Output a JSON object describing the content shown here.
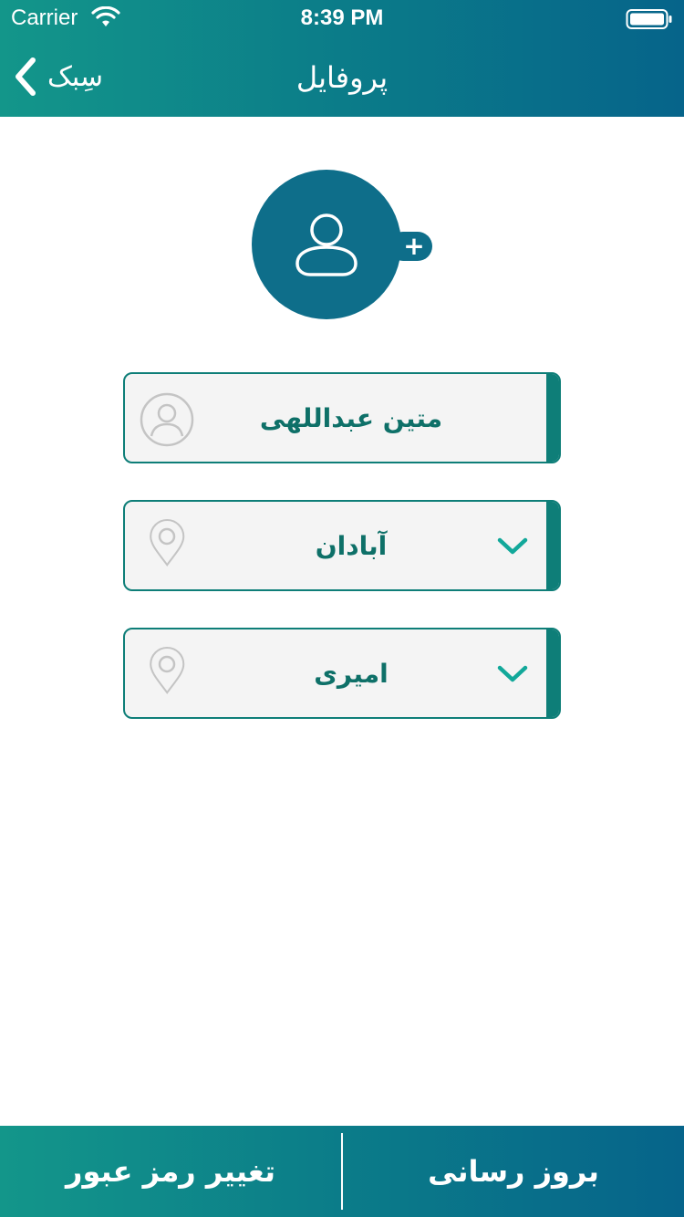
{
  "status_bar": {
    "carrier": "Carrier",
    "time": "8:39 PM",
    "icons": [
      "wifi-icon",
      "battery-icon"
    ]
  },
  "nav": {
    "back_label": "سِبک",
    "title": "پروفایل"
  },
  "profile": {
    "avatar_icon": "person-icon",
    "add_photo_label": "+"
  },
  "fields": {
    "name": {
      "value": "متین عبداللهی",
      "icon": "user-icon"
    },
    "city": {
      "value": "آبادان",
      "icon": "location-pin-icon"
    },
    "area": {
      "value": "امیری",
      "icon": "location-pin-icon"
    }
  },
  "bottom": {
    "change_password_label": "تغییر رمز عبور",
    "update_label": "بروز رسانی"
  },
  "colors": {
    "primary": "#0e7e78",
    "header_gradient_start": "#13968a",
    "header_gradient_end": "#06648a",
    "avatar": "#0e6e8a",
    "field_bg": "#f4f4f4",
    "chevron": "#12a89a"
  }
}
